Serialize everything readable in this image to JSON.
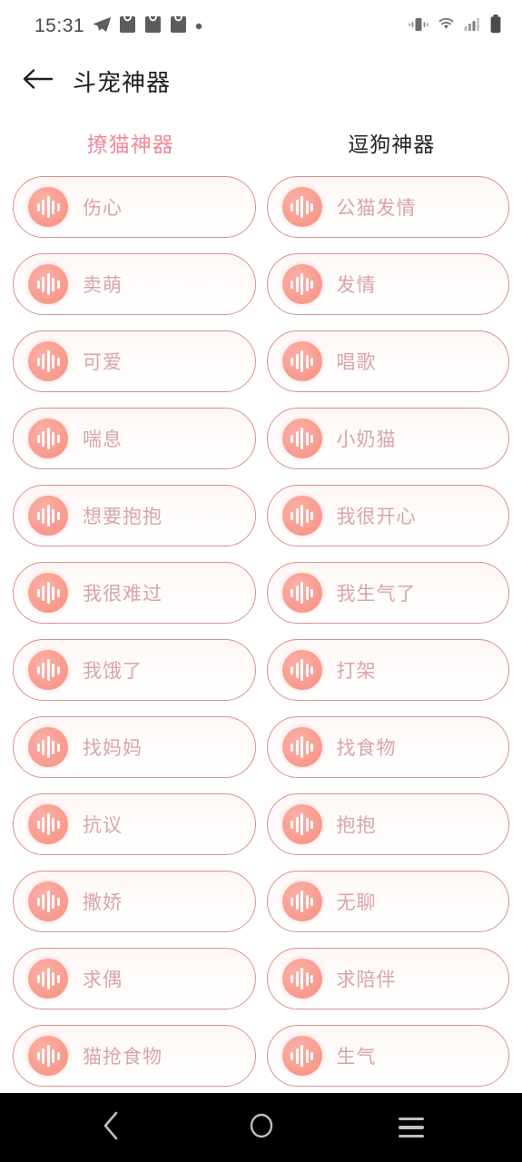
{
  "statusbar": {
    "time": "15:31",
    "left_icons": [
      "telegram-send-icon",
      "app-badge-icon",
      "app-badge-icon",
      "app-badge-icon",
      "dot-icon"
    ],
    "right_icons": [
      "vibrate-icon",
      "wifi-icon",
      "signal-icon",
      "battery-icon"
    ]
  },
  "header": {
    "back_icon": "arrow-left-icon",
    "title": "斗宠神器"
  },
  "tabs": [
    {
      "label": "撩猫神器",
      "active": true
    },
    {
      "label": "逗狗神器",
      "active": false
    }
  ],
  "colors": {
    "accent_pink": "#f08a9c",
    "pill_border": "#d98f92",
    "pill_label": "#d9a3ad",
    "badge_salmon": "#f5907f",
    "title_dark": "#1d1d22",
    "page_background": "#ffffff",
    "navbar_background": "#000000"
  },
  "sound_list": {
    "icon": "sound-wave-icon",
    "left_column": [
      "伤心",
      "卖萌",
      "可爱",
      "喘息",
      "想要抱抱",
      "我很难过",
      "我饿了",
      "找妈妈",
      "抗议",
      "撒娇",
      "求偶",
      "猫抢食物"
    ],
    "right_column": [
      "公猫发情",
      "发情",
      "唱歌",
      "小奶猫",
      "我很开心",
      "我生气了",
      "打架",
      "找食物",
      "抱抱",
      "无聊",
      "求陪伴",
      "生气"
    ]
  },
  "navbar": {
    "back_label": "back-icon",
    "home_label": "home-icon",
    "recents_label": "recents-icon"
  }
}
